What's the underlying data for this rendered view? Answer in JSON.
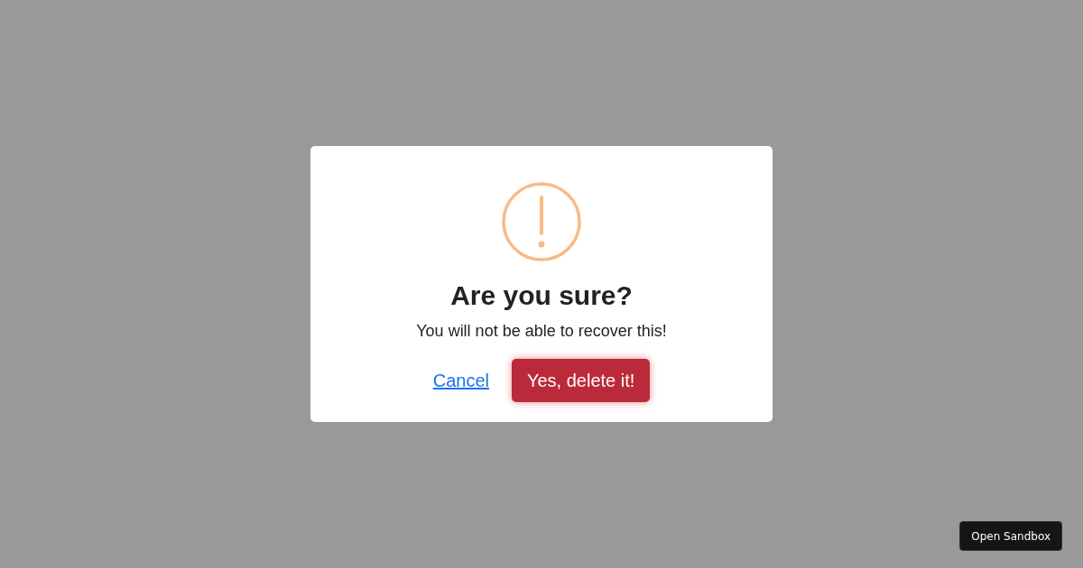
{
  "dialog": {
    "title": "Are you sure?",
    "message": "You will not be able to recover this!",
    "buttons": [
      {
        "label": "Cancel",
        "kind": "link"
      },
      {
        "label": "Yes, delete it!",
        "kind": "danger"
      }
    ]
  },
  "sandbox_button": {
    "label": "Open Sandbox"
  }
}
